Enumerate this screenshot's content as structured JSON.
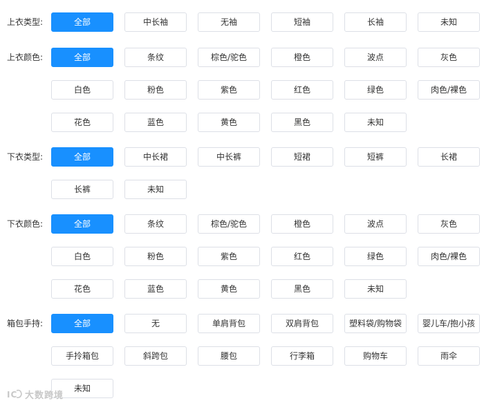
{
  "filters": [
    {
      "label": "上衣类型:",
      "options": [
        "全部",
        "中长袖",
        "无袖",
        "短袖",
        "长袖",
        "未知"
      ],
      "selected": 0
    },
    {
      "label": "上衣颜色:",
      "options": [
        "全部",
        "条纹",
        "棕色/驼色",
        "橙色",
        "波点",
        "灰色",
        "白色",
        "粉色",
        "紫色",
        "红色",
        "绿色",
        "肉色/裸色",
        "花色",
        "蓝色",
        "黄色",
        "黑色",
        "未知"
      ],
      "selected": 0
    },
    {
      "label": "下衣类型:",
      "options": [
        "全部",
        "中长裙",
        "中长裤",
        "短裙",
        "短裤",
        "长裙",
        "长裤",
        "未知"
      ],
      "selected": 0
    },
    {
      "label": "下衣颜色:",
      "options": [
        "全部",
        "条纹",
        "棕色/驼色",
        "橙色",
        "波点",
        "灰色",
        "白色",
        "粉色",
        "紫色",
        "红色",
        "绿色",
        "肉色/裸色",
        "花色",
        "蓝色",
        "黄色",
        "黑色",
        "未知"
      ],
      "selected": 0
    },
    {
      "label": "箱包手持:",
      "options": [
        "全部",
        "无",
        "单肩背包",
        "双肩背包",
        "塑料袋/购物袋",
        "婴儿车/抱小孩",
        "手拎箱包",
        "斜跨包",
        "腰包",
        "行李箱",
        "购物车",
        "雨伞",
        "未知"
      ],
      "selected": 0
    }
  ],
  "watermark": {
    "text": "大数跨境",
    "icon": "ic-logo-icon"
  },
  "colors": {
    "accent": "#1890ff",
    "border": "#dcdfe6",
    "text": "#333333"
  }
}
